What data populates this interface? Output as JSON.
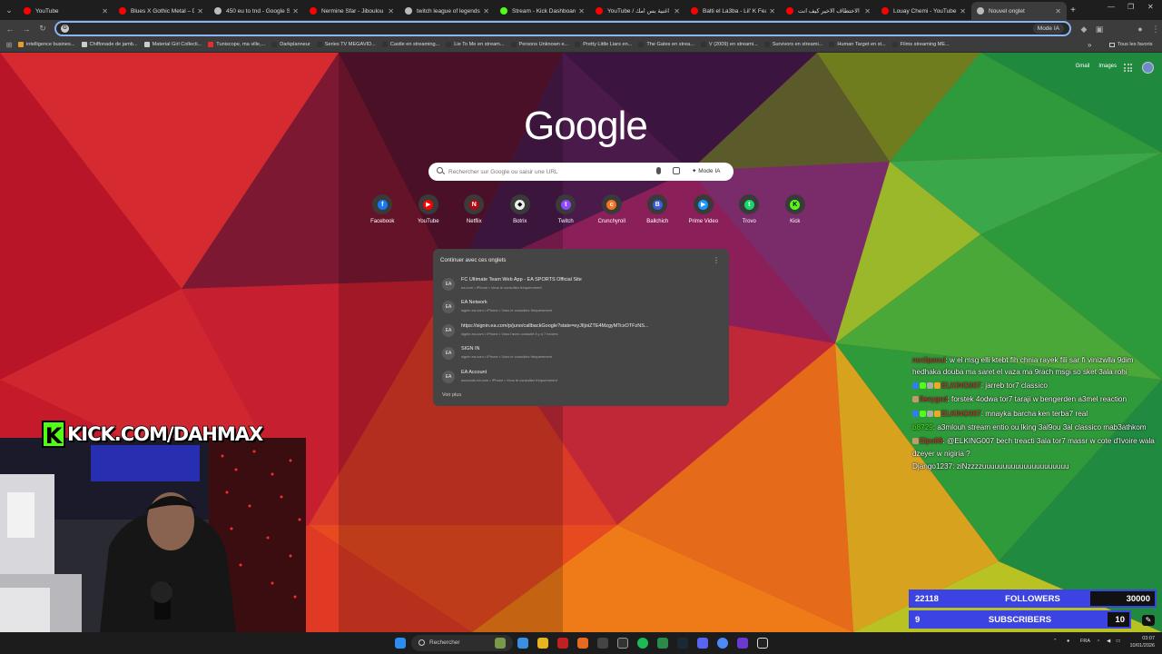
{
  "browser": {
    "tabs": [
      {
        "title": "YouTube",
        "color": "#ff0000"
      },
      {
        "title": "Blues X Gothic Metal – Da",
        "color": "#ff0000"
      },
      {
        "title": "450 eu to tnd - Google Se",
        "color": "#bbbbbb"
      },
      {
        "title": "Nermine Sfar - Jiboulou 'L",
        "color": "#ff0000"
      },
      {
        "title": "twitch league of legends",
        "color": "#bbbbbb"
      },
      {
        "title": "Stream - Kick Dashboard",
        "color": "#53fc18"
      },
      {
        "title": "YouTube / اغنية بس امك",
        "color": "#ff0000"
      },
      {
        "title": "Balti el La3ba - Lil' K Fea",
        "color": "#ff0000"
      },
      {
        "title": "الاختطاف الاخير كيف انت",
        "color": "#ff0000"
      },
      {
        "title": "Louay Chemi - YouTube",
        "color": "#ff0000"
      },
      {
        "title": "Nouvel onglet",
        "color": "#bbbbbb",
        "active": true
      }
    ],
    "omnibox_mode": "Mode IA",
    "bookmarks": [
      {
        "label": "intelligence busines...",
        "color": "#e0a030"
      },
      {
        "label": "Chiffonade de jamb...",
        "color": "#cccccc"
      },
      {
        "label": "Material Girl Collecti...",
        "color": "#cccccc"
      },
      {
        "label": "Tuniscope, ma ville,...",
        "color": "#e03030"
      },
      {
        "label": "Darkplanneur",
        "color": "#333333"
      },
      {
        "label": "Series TV MEGAVID...",
        "color": "#333333"
      },
      {
        "label": "Castle en streaming...",
        "color": "#333333"
      },
      {
        "label": "Lie To Me en stream...",
        "color": "#333333"
      },
      {
        "label": "Persons Unknown e...",
        "color": "#333333"
      },
      {
        "label": "Pretty Little Liars en...",
        "color": "#333333"
      },
      {
        "label": "The Gates en strea...",
        "color": "#333333"
      },
      {
        "label": "V (2009) en streami...",
        "color": "#333333"
      },
      {
        "label": "Survivors en streami...",
        "color": "#333333"
      },
      {
        "label": "Human Target en st...",
        "color": "#333333"
      },
      {
        "label": "Films streaming ME...",
        "color": "#333333"
      }
    ],
    "bookmarks_more": "»",
    "all_bookmarks": "Tous les favoris"
  },
  "newtab": {
    "top_links": [
      "Gmail",
      "Images"
    ],
    "logo": "Google",
    "search_placeholder": "Rechercher sur Google ou saisir une URL",
    "search_mode": "Mode IA",
    "shortcuts": [
      {
        "label": "Facebook",
        "color": "#1877f2",
        "glyph": "f"
      },
      {
        "label": "YouTube",
        "color": "#ff0000",
        "glyph": "▶"
      },
      {
        "label": "Netflix",
        "color": "#b20710",
        "glyph": "N"
      },
      {
        "label": "Botrix",
        "color": "#eeeeee",
        "glyph": "◆"
      },
      {
        "label": "Twitch",
        "color": "#9146ff",
        "glyph": "t"
      },
      {
        "label": "Crunchyroll",
        "color": "#f47521",
        "glyph": "c"
      },
      {
        "label": "Ballchich",
        "color": "#3b5bdb",
        "glyph": "B"
      },
      {
        "label": "Prime Video",
        "color": "#1a98ff",
        "glyph": "▶"
      },
      {
        "label": "Trovo",
        "color": "#19d66b",
        "glyph": "t"
      },
      {
        "label": "Kick",
        "color": "#53fc18",
        "glyph": "K"
      }
    ],
    "continue": {
      "heading": "Continuer avec ces onglets",
      "items": [
        {
          "title": "FC Ultimate Team Web App - EA SPORTS Official Site",
          "sub": "ea.com • iPhone • Vous le consultez fréquemment"
        },
        {
          "title": "EA Network",
          "sub": "signin.ea.com • iPhone • Vous le consultez fréquemment"
        },
        {
          "title": "https://signin.ea.com/p/juno/callbackGoogle?state=eyJlIjoiZTE4MzgyMTcxOTFzNS...",
          "sub": "signin.ea.com • iPhone • Vous l'avez consulté il y a 7 heures"
        },
        {
          "title": "SIGN IN",
          "sub": "signin.ea.com • iPhone • Vous le consultez fréquemment"
        },
        {
          "title": "EA Account",
          "sub": "accounts.ea.com • iPhone • Vous le consultez fréquemment"
        }
      ],
      "more": "Voir plus"
    }
  },
  "stream": {
    "kick_url": "KICK.COM/DAHMAX",
    "kick_letter": "K",
    "chat": [
      {
        "user": "noclipsoul",
        "color": "#e23b3b",
        "text": ": w el msg elli ktebt fih chnia rayek fili sar fi vinizwlla 9dim hedhaka douba ma saret el vaza ma 9rach msgi so sket 3ala rohi",
        "badges": []
      },
      {
        "user": "ELKING007",
        "color": "#e23b3b",
        "text": ": jarreb tor7 classico",
        "badges": [
          "#2d7ff9",
          "#53fc18",
          "#aaaaaa",
          "#f5a623"
        ]
      },
      {
        "user": "flexygod",
        "color": "#e23b3b",
        "text": ": forstek 4odwa tor7 taraji w bengerden a3mel reaction",
        "badges": [
          "#c49a6c"
        ]
      },
      {
        "user": "ELKING007",
        "color": "#e23b3b",
        "text": ": mnayka barcha ken terba7 real",
        "badges": [
          "#2d7ff9",
          "#53fc18",
          "#aaaaaa",
          "#f5a623"
        ]
      },
      {
        "user": "b8729",
        "color": "#53fc18",
        "text": ": a3mlouh stream entio ou lking 3al9ou 3al classico mab3athkom",
        "badges": []
      },
      {
        "user": "Elpo99",
        "color": "#e23b3b",
        "text": ": @ELKING007 bech treacti 3ala tor7 massr w cote d'Ivoire wala dzeyer w nigiria ?",
        "badges": [
          "#c49a6c"
        ]
      },
      {
        "user": "Django1237",
        "color": "#ffffff",
        "text": ": ziNzzzzuuuuuuuuuuuuuuuuuuuuu",
        "badges": []
      }
    ],
    "followers": {
      "current": "22118",
      "label": "FOLLOWERS",
      "target": "30000",
      "progress": 0.737
    },
    "subscribers": {
      "current": "9",
      "label": "SUBSCRIBERS",
      "target": "10",
      "progress": 0.9
    },
    "accent": "#3b43e2"
  },
  "taskbar": {
    "search": "Rechercher",
    "lang": "FRA",
    "time": "03:07",
    "date": "10/01/2026"
  }
}
